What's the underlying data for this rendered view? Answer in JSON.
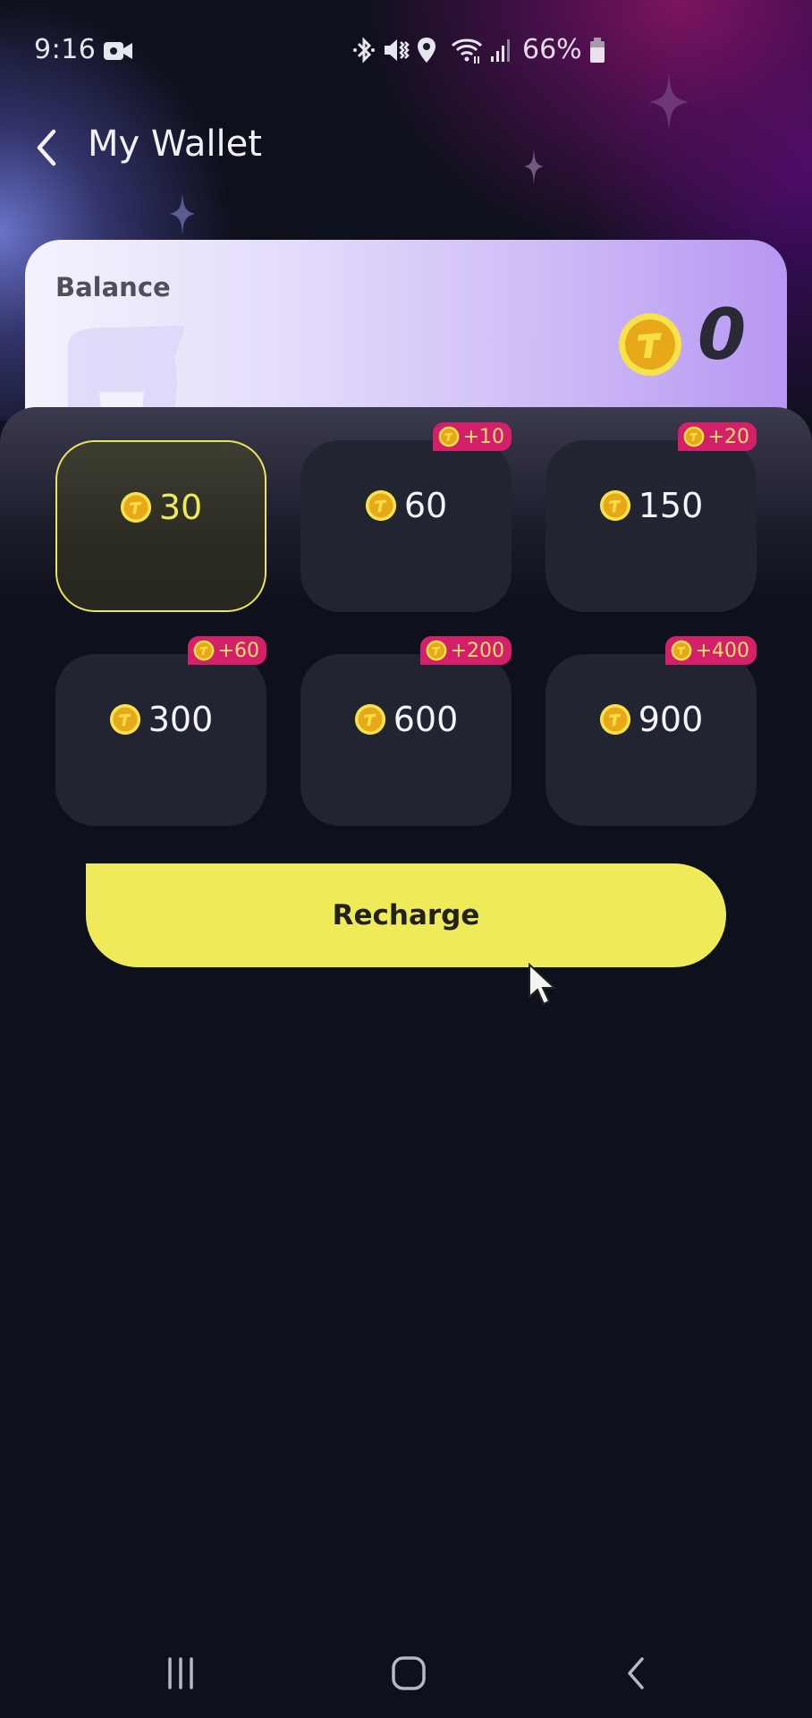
{
  "status_bar": {
    "time": "9:16",
    "battery_percent": "66%",
    "icons": [
      "video-camera-icon",
      "bluetooth-icon",
      "vibrate-mute-icon",
      "location-icon",
      "wifi-icon",
      "signal-icon",
      "battery-icon"
    ]
  },
  "header": {
    "back_icon": "chevron-left-icon",
    "title": "My Wallet"
  },
  "balance": {
    "label": "Balance",
    "coin_icon": "t-coin-icon",
    "value": "0"
  },
  "packages": [
    {
      "amount": "30",
      "bonus": null,
      "selected": true
    },
    {
      "amount": "60",
      "bonus": "+10",
      "selected": false
    },
    {
      "amount": "150",
      "bonus": "+20",
      "selected": false
    },
    {
      "amount": "300",
      "bonus": "+60",
      "selected": false
    },
    {
      "amount": "600",
      "bonus": "+200",
      "selected": false
    },
    {
      "amount": "900",
      "bonus": "+400",
      "selected": false
    }
  ],
  "recharge_button": {
    "label": "Recharge"
  },
  "colors": {
    "accent_yellow": "#eeea5a",
    "bonus_badge": "#d41f6a",
    "background": "#0e101c",
    "tile": "#222432"
  },
  "nav_bar": {
    "icons": [
      "recent-apps-icon",
      "home-icon",
      "back-icon"
    ]
  }
}
